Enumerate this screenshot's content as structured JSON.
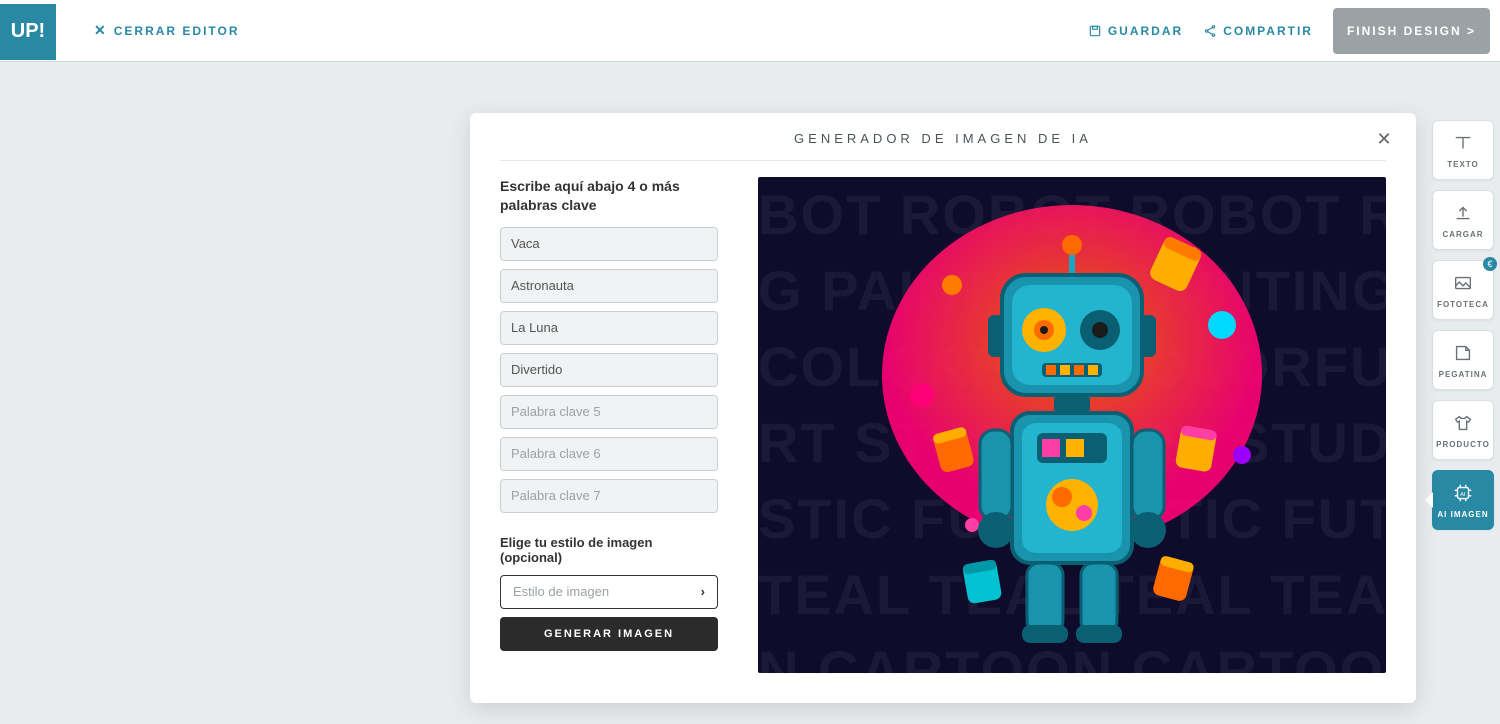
{
  "logo_text": "UP!",
  "header": {
    "close_editor": "CERRAR EDITOR",
    "save": "GUARDAR",
    "share": "COMPARTIR",
    "finish": "FINISH DESIGN >"
  },
  "tools": {
    "texto": "TEXTO",
    "cargar": "CARGAR",
    "fototeca": "FOTOTECA",
    "pegatina": "PEGATINA",
    "producto": "PRODUCTO",
    "ai_imagen": "AI IMAGEN"
  },
  "modal": {
    "title": "GENERADOR DE IMAGEN DE IA",
    "prompt_label": "Escribe aquí abajo 4 o más palabras clave",
    "keywords": {
      "k1": "Vaca",
      "k2": "Astronauta",
      "k3": "La Luna",
      "k4": "Divertido"
    },
    "placeholders": {
      "p5": "Palabra clave 5",
      "p6": "Palabra clave 6",
      "p7": "Palabra clave 7"
    },
    "style_label": "Elige tu estilo de imagen (opcional)",
    "style_placeholder": "Estilo de imagen",
    "generate": "GENERAR IMAGEN",
    "bg_words": {
      "l1": "BOT ROBOT ROBOT ROBOT ROB",
      "l2": "G PAINTING PAINTING PAINTING P",
      "l3": "COLORFUL COLORFUL COLORFUL",
      "l4": "RT STUDIO ART STUDIO ART STUD",
      "l5": "STIC FUTURISTIC FUTURISTIC FUTU",
      "l6": "TEAL TEAL TEAL TEAL TEAL TEAL",
      "l7": "N CARTOON CARTOON CARTOON C"
    }
  }
}
